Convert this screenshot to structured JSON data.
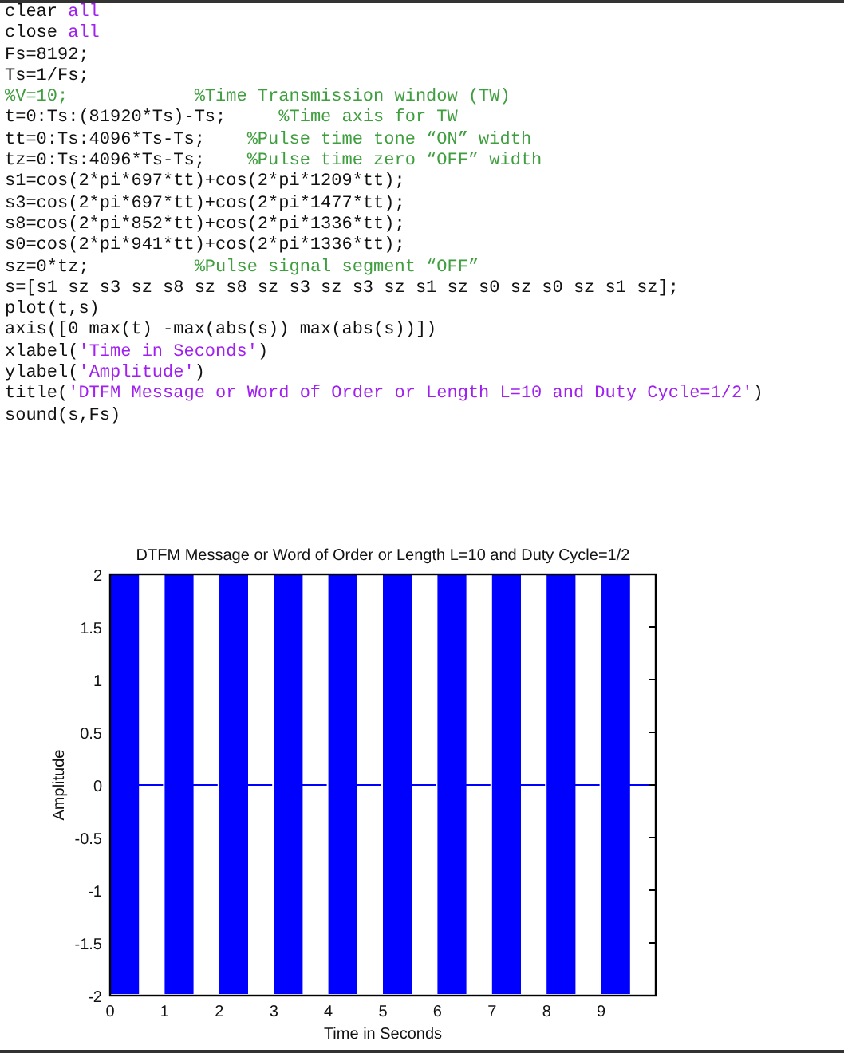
{
  "code_lines": [
    {
      "segments": [
        {
          "kind": "code",
          "text": "clear "
        },
        {
          "kind": "keyword",
          "text": "all"
        }
      ]
    },
    {
      "segments": [
        {
          "kind": "code",
          "text": "close "
        },
        {
          "kind": "keyword",
          "text": "all"
        }
      ]
    },
    {
      "segments": [
        {
          "kind": "code",
          "text": "Fs=8192;"
        }
      ]
    },
    {
      "segments": [
        {
          "kind": "code",
          "text": "Ts=1/Fs;"
        }
      ]
    },
    {
      "segments": [
        {
          "kind": "comment",
          "text": "%V=10;            %Time Transmission window (TW)"
        }
      ]
    },
    {
      "segments": [
        {
          "kind": "code",
          "text": "t=0:Ts:(81920*Ts)-Ts;     "
        },
        {
          "kind": "comment",
          "text": "%Time axis for TW"
        }
      ]
    },
    {
      "segments": [
        {
          "kind": "code",
          "text": "tt=0:Ts:4096*Ts-Ts;    "
        },
        {
          "kind": "comment",
          "text": "%Pulse time tone “ON” width"
        }
      ]
    },
    {
      "segments": [
        {
          "kind": "code",
          "text": "tz=0:Ts:4096*Ts-Ts;    "
        },
        {
          "kind": "comment",
          "text": "%Pulse time zero “OFF” width"
        }
      ]
    },
    {
      "segments": [
        {
          "kind": "code",
          "text": "s1=cos(2*pi*697*tt)+cos(2*pi*1209*tt);"
        }
      ]
    },
    {
      "segments": [
        {
          "kind": "code",
          "text": "s3=cos(2*pi*697*tt)+cos(2*pi*1477*tt);"
        }
      ]
    },
    {
      "segments": [
        {
          "kind": "code",
          "text": "s8=cos(2*pi*852*tt)+cos(2*pi*1336*tt);"
        }
      ]
    },
    {
      "segments": [
        {
          "kind": "code",
          "text": "s0=cos(2*pi*941*tt)+cos(2*pi*1336*tt);"
        }
      ]
    },
    {
      "segments": [
        {
          "kind": "code",
          "text": "sz=0*tz;          "
        },
        {
          "kind": "comment",
          "text": "%Pulse signal segment “OFF”"
        }
      ]
    },
    {
      "segments": [
        {
          "kind": "code",
          "text": "s=[s1 sz s3 sz s8 sz s8 sz s3 sz s3 sz s1 sz s0 sz s0 sz s1 sz];"
        }
      ]
    },
    {
      "segments": [
        {
          "kind": "code",
          "text": "plot(t,s)"
        }
      ]
    },
    {
      "segments": [
        {
          "kind": "code",
          "text": "axis([0 max(t) -max(abs(s)) max(abs(s))])"
        }
      ]
    },
    {
      "segments": [
        {
          "kind": "code",
          "text": "xlabel("
        },
        {
          "kind": "string",
          "text": "'Time in Seconds'"
        },
        {
          "kind": "code",
          "text": ")"
        }
      ]
    },
    {
      "segments": [
        {
          "kind": "code",
          "text": "ylabel("
        },
        {
          "kind": "string",
          "text": "'Amplitude'"
        },
        {
          "kind": "code",
          "text": ")"
        }
      ]
    },
    {
      "segments": [
        {
          "kind": "code",
          "text": "title("
        },
        {
          "kind": "string",
          "text": "'DTFM Message or Word of Order or Length L=10 and Duty Cycle=1/2'"
        },
        {
          "kind": "code",
          "text": ")"
        }
      ]
    },
    {
      "segments": [
        {
          "kind": "code",
          "text": "sound(s,Fs)"
        }
      ]
    }
  ],
  "figure": {
    "title": "DTFM Message or Word of Order or Length L=10 and Duty Cycle=1/2",
    "xlabel": "Time in Seconds",
    "ylabel": "Amplitude",
    "xticks": [
      "0",
      "1",
      "2",
      "3",
      "4",
      "5",
      "6",
      "7",
      "8",
      "9"
    ],
    "yticks": [
      "2",
      "1.5",
      "1",
      "0.5",
      "0",
      "-0.5",
      "-1",
      "-1.5",
      "-2"
    ]
  }
}
